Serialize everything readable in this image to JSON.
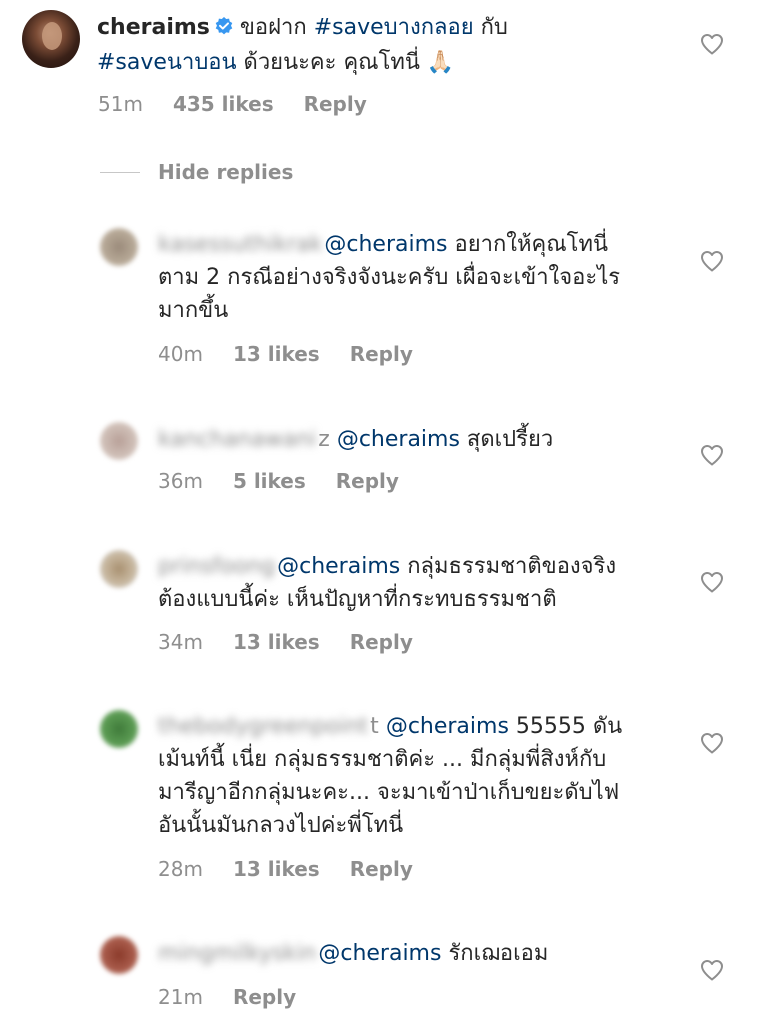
{
  "main_comment": {
    "username": "cheraims",
    "text_part1": "ขอฝาก ",
    "hashtag1": "#saveบางกลอย",
    "text_part2": " กับ",
    "hashtag2": "#saveนาบอน",
    "text_part3": " ด้วยนะคะ คุณโทนี่ 🙏🏻",
    "time": "51m",
    "likes": "435 likes",
    "reply_label": "Reply"
  },
  "hide_replies_label": "Hide replies",
  "replies": [
    {
      "blurred_name": "kasessuthikrak",
      "name_tail": "",
      "mention": "@cheraims",
      "line1": " อยากให้คุณโทนี่",
      "rest": "ตาม 2 กรณีอย่างจริงจังนะครับ เผื่อจะเข้าใจอะไร\nมากขึ้น",
      "time": "40m",
      "likes": "13 likes",
      "reply_label": "Reply"
    },
    {
      "blurred_name": "kanchanawani",
      "name_tail": "z",
      "mention": "@cheraims",
      "line1": " สุดเปรี้ยว",
      "rest": "",
      "time": "36m",
      "likes": "5 likes",
      "reply_label": "Reply"
    },
    {
      "blurred_name": "prinsfoong",
      "name_tail": "",
      "mention": "@cheraims",
      "line1": " กลุ่มธรรมชาติของจริง",
      "rest": "ต้องแบบนี้ค่ะ เห็นปัญหาที่กระทบธรรมชาติ",
      "time": "34m",
      "likes": "13 likes",
      "reply_label": "Reply"
    },
    {
      "blurred_name": "thebodygreenpoint",
      "name_tail": "t",
      "mention": "@cheraims",
      "line1": " 55555 ดัน",
      "rest": "เม้นท์นี้ เนี่ย กลุ่มธรรมชาติค่ะ ... มีกลุ่มพี่สิงห์กับ\nมารีญาอีกกลุ่มนะคะ... จะมาเข้าป่าเก็บขยะดับไฟ\nอันนั้นมันกลวงไปค่ะพี่โทนี่",
      "time": "28m",
      "likes": "13 likes",
      "reply_label": "Reply"
    },
    {
      "blurred_name": "mingmilkyskin",
      "name_tail": "",
      "mention": "@cheraims",
      "line1": " รักเฌอเอม",
      "rest": "",
      "time": "21m",
      "likes": "",
      "reply_label": "Reply"
    }
  ],
  "colors": {
    "text": "#262626",
    "secondary": "#8e8e8e",
    "link": "#00376b",
    "verified": "#3897f0"
  },
  "icons": {
    "heart": "heart-outline-icon",
    "verified": "verified-badge-icon"
  }
}
